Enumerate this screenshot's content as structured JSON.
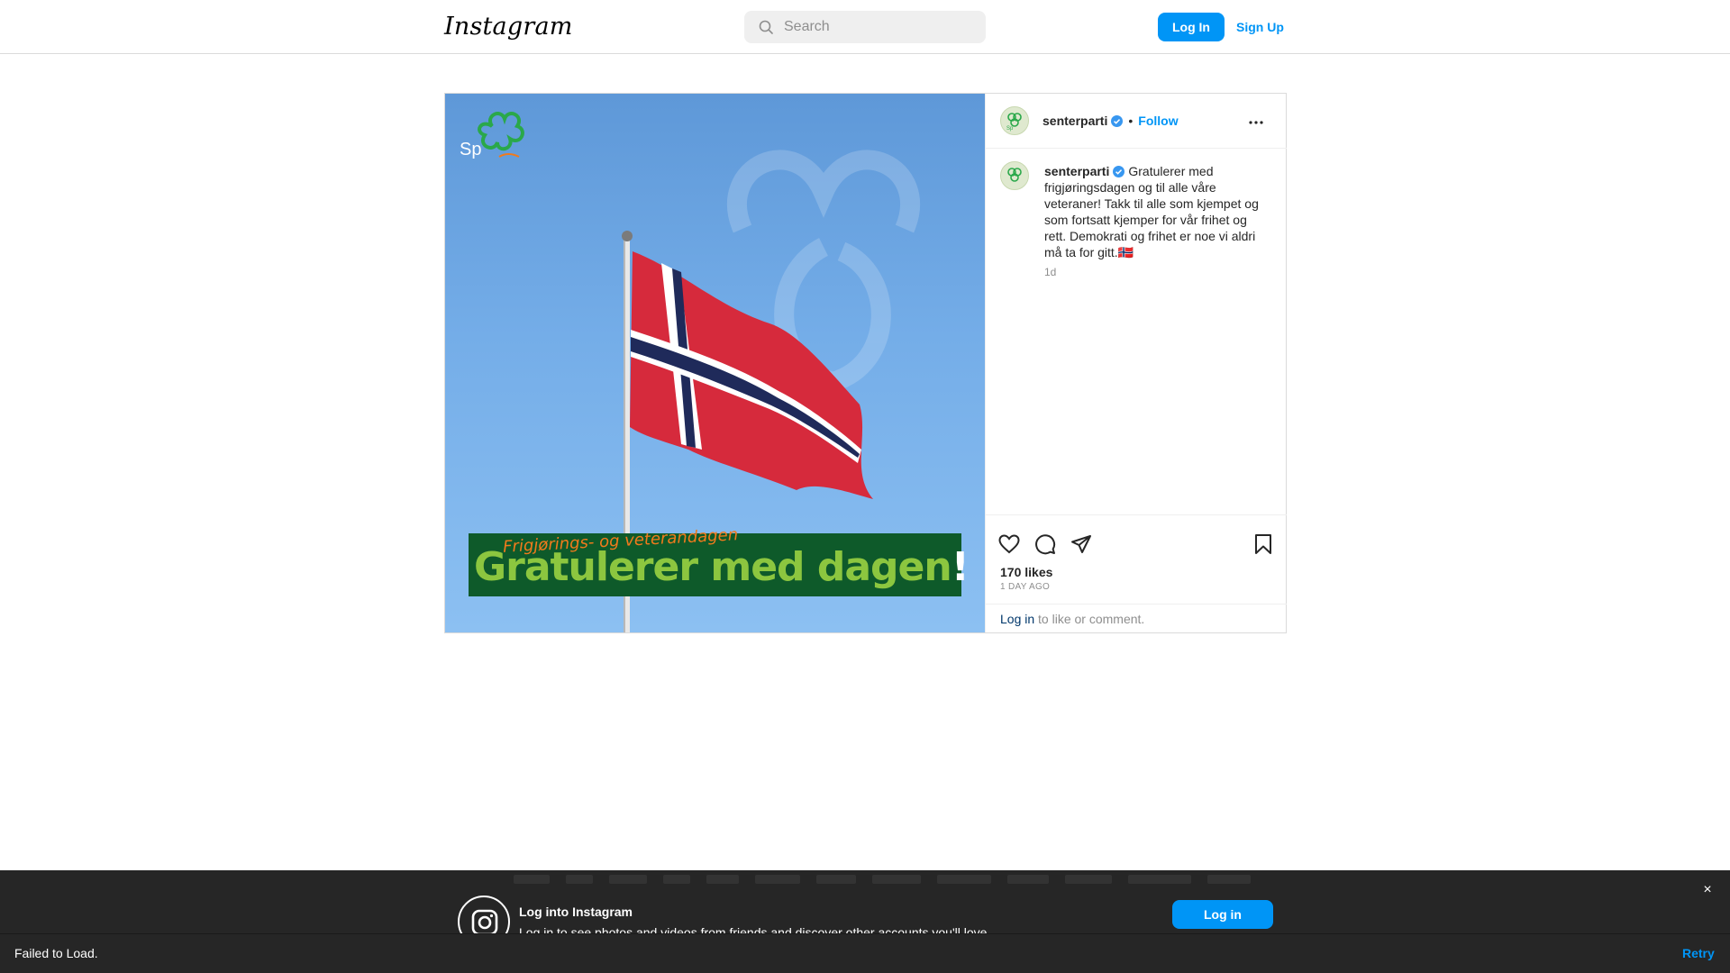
{
  "nav": {
    "logo": "Instagram",
    "search_placeholder": "Search",
    "login_label": "Log In",
    "signup_label": "Sign Up"
  },
  "post": {
    "image": {
      "brand_mark": "Sp",
      "banner_subtitle": "Frigjørings- og veterandagen",
      "banner_title": "Gratulerer med dagen",
      "banner_bang": "!"
    },
    "header": {
      "username": "senterparti",
      "separator": "•",
      "follow_label": "Follow"
    },
    "caption": {
      "username": "senterparti",
      "text": "Gratulerer med frigjøringsdagen og til alle våre veteraner! Takk til alle som kjempet og som fortsatt kjemper for vår frihet og rett. Demokrati og frihet er noe vi aldri må ta for gitt.🇳🇴",
      "time": "1d"
    },
    "likes": "170 likes",
    "date": "1 DAY AGO",
    "comment_link": "Log in",
    "comment_rest": " to like or comment."
  },
  "login_prompt": {
    "title": "Log into Instagram",
    "description": "Log in to see photos and videos from friends and discover other accounts you'll love.",
    "button": "Log in",
    "close": "×"
  },
  "snackbar": {
    "message": "Failed to Load.",
    "retry": "Retry"
  },
  "colors": {
    "accent": "#0095f6",
    "border": "#dbdbdb",
    "verified": "#3897f0",
    "banner_bg": "#0e5a2a",
    "banner_text": "#8cc63f",
    "banner_subtext": "#f07a1c"
  },
  "icons": [
    "search-icon",
    "verified-icon",
    "more-icon",
    "heart-icon",
    "comment-icon",
    "share-icon",
    "bookmark-icon",
    "instagram-icon",
    "close-icon"
  ]
}
